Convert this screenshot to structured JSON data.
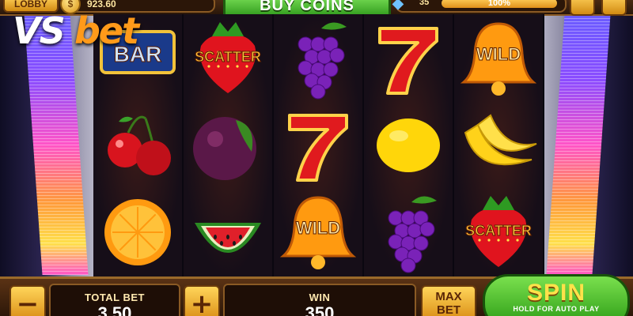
{
  "topbar": {
    "lobby_label": "LOBBY",
    "coin_balance": "923.60",
    "buy_coins_label": "BUY COINS",
    "level_number": "35",
    "level_progress": 1.0,
    "level_progress_label": "100%"
  },
  "logo": {
    "vs": "VS",
    "bet": "bet"
  },
  "reels": [
    [
      "bar",
      "cherry",
      "orange"
    ],
    [
      "strawberry-scatter",
      "plum",
      "watermelon"
    ],
    [
      "grapes",
      "seven",
      "bell-wild"
    ],
    [
      "seven",
      "lemon",
      "grapes"
    ],
    [
      "bell-wild",
      "banana",
      "strawberry-scatter"
    ]
  ],
  "symbol_text": {
    "bar": "BAR",
    "scatter": "SCATTER",
    "wild": "WILD"
  },
  "controls": {
    "minus_label": "−",
    "plus_label": "+",
    "total_bet_label": "TOTAL BET",
    "total_bet_value": "3.50",
    "win_label": "WIN",
    "win_value": "350",
    "max_bet_line1": "MAX",
    "max_bet_line2": "BET",
    "spin_label": "SPIN",
    "spin_sublabel": "HOLD FOR AUTO PLAY"
  },
  "colors": {
    "accent_gold": "#ffcc3a",
    "spin_green": "#2a9a14",
    "logo_orange": "#ff9a1a"
  }
}
